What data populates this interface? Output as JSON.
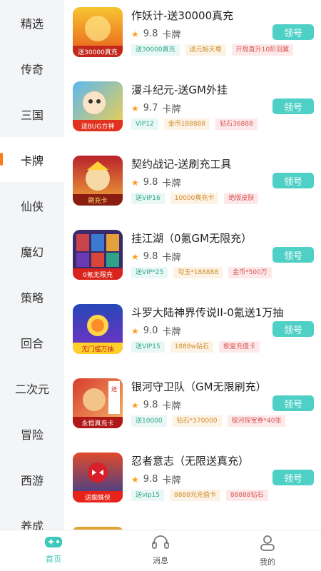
{
  "sidebar": {
    "categories": [
      "精选",
      "传奇",
      "三国",
      "卡牌",
      "仙侠",
      "魔幻",
      "策略",
      "回合",
      "二次元",
      "冒险",
      "西游",
      "养成"
    ],
    "active": "卡牌"
  },
  "games": [
    {
      "title": "作妖计-送30000真充",
      "score": "9.8",
      "type": "卡牌",
      "button": "领号",
      "tags": [
        "送30000真充",
        "送元始天尊",
        "开局直升10阶羽翼"
      ],
      "thumb_text": "送30000真充"
    },
    {
      "title": "漫斗纪元-送GM外挂",
      "score": "9.7",
      "type": "卡牌",
      "button": "领号",
      "tags": [
        "VIP12",
        "金币188888",
        "钻石36888"
      ],
      "thumb_text": "送BUG方神"
    },
    {
      "title": "契约战记-送刷充工具",
      "score": "9.8",
      "type": "卡牌",
      "button": "领号",
      "tags": [
        "送VIP16",
        "10000真充卡",
        "绝版皮肤"
      ],
      "thumb_text": "刷充卡"
    },
    {
      "title": "挂江湖（0氪GM无限充）",
      "score": "9.8",
      "type": "卡牌",
      "button": "领号",
      "tags": [
        "送VIP*25",
        "勾玉*188888",
        "金币*500万"
      ],
      "thumb_text": "0氪无限充"
    },
    {
      "title": "斗罗大陆神界传说II-0氪送1万抽",
      "score": "9.0",
      "type": "卡牌",
      "button": "领号",
      "tags": [
        "送VIP15",
        "1888w钻石",
        "歌皇充值卡"
      ],
      "thumb_text": "无门槛万抽"
    },
    {
      "title": "银河守卫队（GM无限刷充）",
      "score": "9.8",
      "type": "卡牌",
      "button": "领号",
      "tags": [
        "送10000",
        "钻石*370000",
        "银河探宝券*40张"
      ],
      "thumb_text": "永恒真充卡"
    },
    {
      "title": "忍者意志（无限送真充）",
      "score": "9.8",
      "type": "卡牌",
      "button": "领号",
      "tags": [
        "送vip15",
        "8888元充值卡",
        "88888钻石"
      ],
      "thumb_text": "送蜘蛛侠"
    }
  ],
  "nav": [
    {
      "label": "首页",
      "icon": "gamepad-icon",
      "active": true
    },
    {
      "label": "消息",
      "icon": "headset-icon",
      "active": false
    },
    {
      "label": "我的",
      "icon": "user-icon",
      "active": false
    }
  ],
  "colors": {
    "accent": "#4fd0c6",
    "sidebar_indicator": "#ff7a1a",
    "star": "#ff9c1a"
  }
}
